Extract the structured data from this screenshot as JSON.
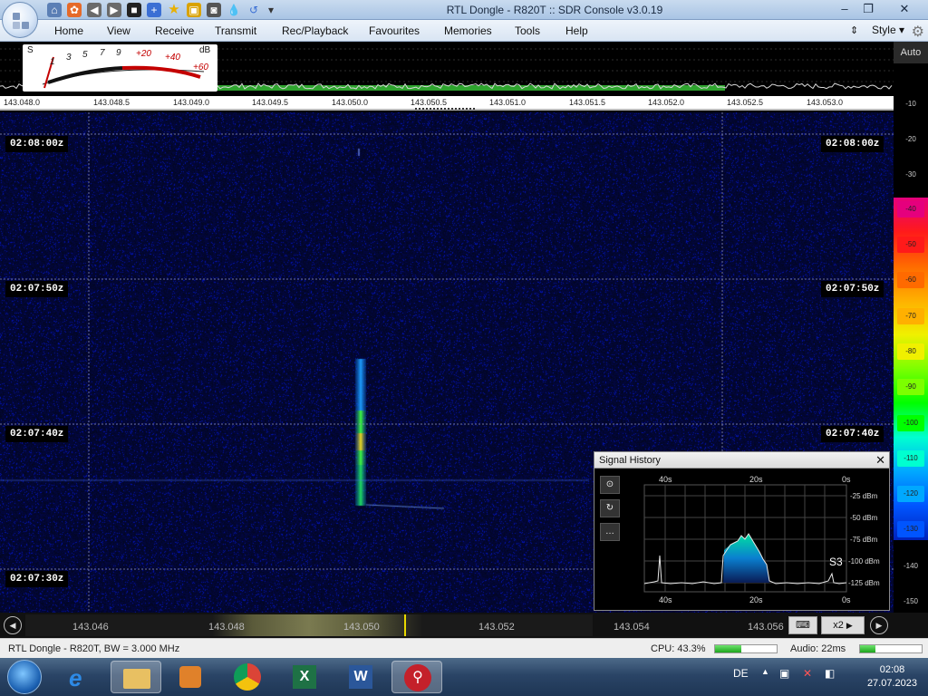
{
  "window": {
    "title": "RTL Dongle - R820T :: SDR Console v3.0.19",
    "controls": [
      "–",
      "❐",
      "✕"
    ]
  },
  "menu": {
    "items": [
      "Home",
      "View",
      "Receive",
      "Transmit",
      "Rec/Playback",
      "Favourites",
      "Memories",
      "Tools",
      "Help"
    ],
    "style_label": "Style"
  },
  "smeter": {
    "s_label": "S",
    "db_label": "dB",
    "s_ticks": [
      "1",
      "3",
      "5",
      "7",
      "9"
    ],
    "db_ticks": [
      "+20",
      "+40",
      "+60"
    ]
  },
  "spectrum": {
    "auto_label": "Auto",
    "ruler_ticks": [
      "143.048.0",
      "143.048.5",
      "143.049.0",
      "143.049.5",
      "143.050.0",
      "143.050.5",
      "143.051.0",
      "143.051.5",
      "143.052.0",
      "143.052.5",
      "143.053.0"
    ]
  },
  "waterfall": {
    "timestamps": [
      "02:08:00z",
      "02:07:50z",
      "02:07:40z",
      "02:07:30z"
    ]
  },
  "dbscale": {
    "labels": [
      "-10",
      "-20",
      "-30",
      "-40",
      "-50",
      "-60",
      "-70",
      "-80",
      "-90",
      "-100",
      "-110",
      "-120",
      "-130",
      "-140",
      "-150"
    ],
    "colors": [
      "#e5007d",
      "#ff1a1a",
      "#ff6a00",
      "#ffb000",
      "#f0f000",
      "#7cff00",
      "#00ff00",
      "#00ffd0",
      "#00a8ff",
      "#0055ff",
      "#0022bb"
    ]
  },
  "signal_history": {
    "title": "Signal History",
    "time_top": [
      "40s",
      "20s",
      "0s"
    ],
    "time_bottom": [
      "40s",
      "20s",
      "0s"
    ],
    "levels": [
      "-25 dBm",
      "-50 dBm",
      "-75 dBm",
      "-100 dBm",
      "-125 dBm"
    ],
    "s_reading": "S3",
    "buttons": [
      "⊙",
      "↻",
      "…"
    ]
  },
  "tuning": {
    "ticks": [
      "143.046",
      "143.048",
      "143.050",
      "143.052",
      "143.054",
      "143.056"
    ],
    "zoom_label": "x2"
  },
  "status": {
    "device": "RTL Dongle - R820T, BW = 3.000 MHz",
    "cpu": "CPU: 43.3%",
    "cpu_fraction": 0.43,
    "audio": "Audio: 22ms",
    "audio_fraction": 0.25
  },
  "taskbar": {
    "lang": "DE",
    "time": "02:08",
    "date": "27.07.2023"
  }
}
